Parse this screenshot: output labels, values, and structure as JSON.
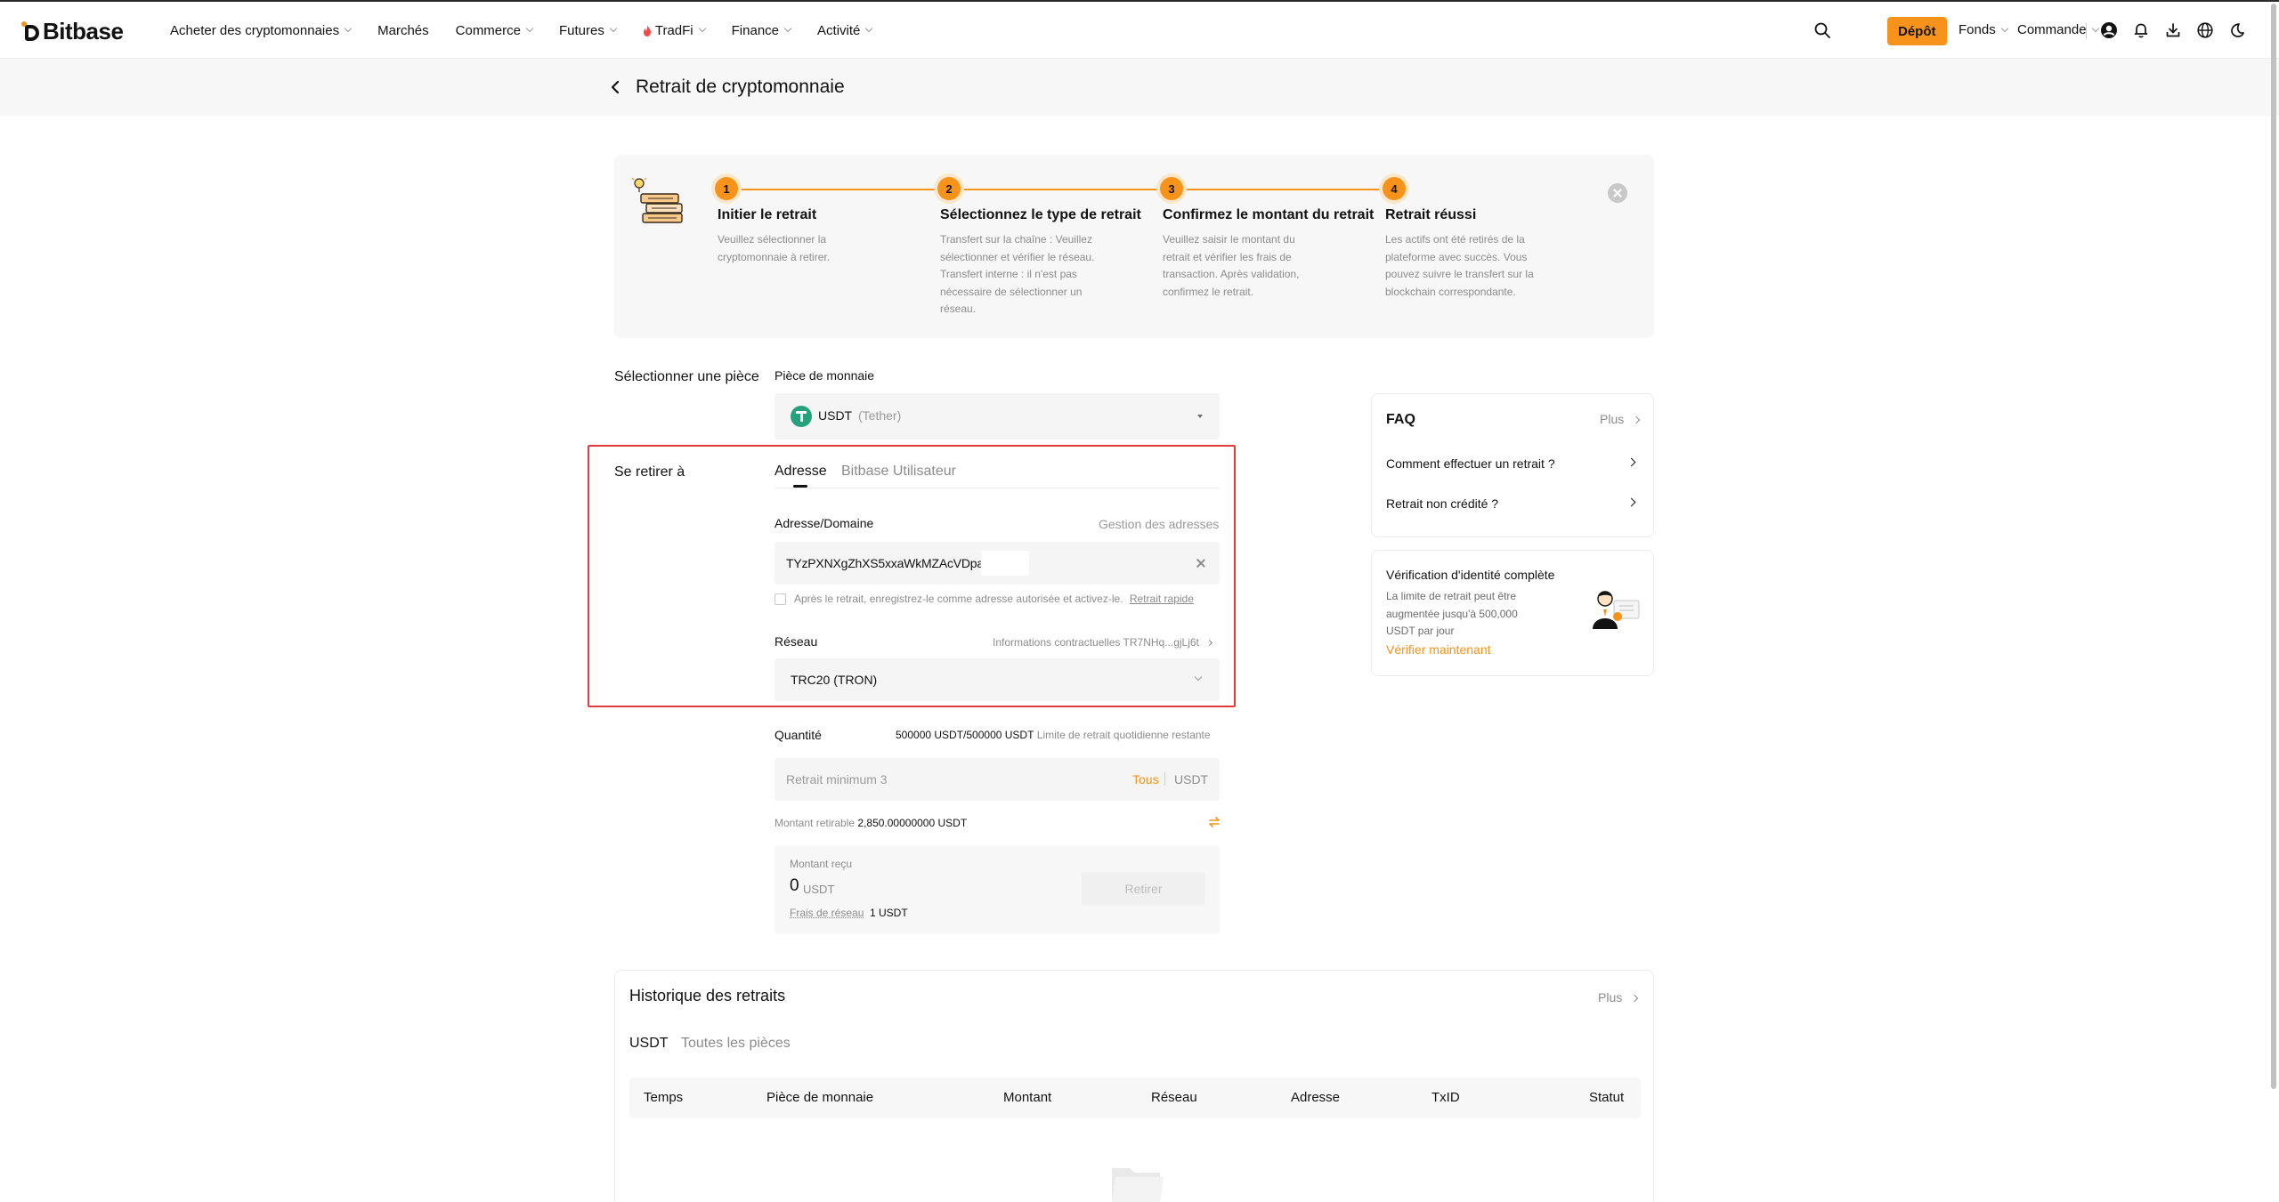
{
  "nav": {
    "logo_text": "Bitbase",
    "items": [
      {
        "label": "Acheter des cryptomonnaies",
        "chevron": true
      },
      {
        "label": "Marchés",
        "chevron": false
      },
      {
        "label": "Commerce",
        "chevron": true
      },
      {
        "label": "Futures",
        "chevron": true
      },
      {
        "label": "TradFi",
        "chevron": true,
        "icon": "flame-icon"
      },
      {
        "label": "Finance",
        "chevron": true
      },
      {
        "label": "Activité",
        "chevron": true
      }
    ],
    "deposit_label": "Dépôt",
    "funds_label": "Fonds",
    "order_label": "Commande",
    "icons": [
      "search-icon",
      "account-icon",
      "bell-icon",
      "download-icon",
      "globe-icon",
      "theme-icon"
    ]
  },
  "page": {
    "title": "Retrait de cryptomonnaie"
  },
  "steps": [
    {
      "num": "1",
      "title": "Initier le retrait",
      "desc": "Veuillez sélectionner la cryptomonnaie à retirer."
    },
    {
      "num": "2",
      "title": "Sélectionnez le type de retrait",
      "desc": "Transfert sur la chaîne : Veuillez sélectionner et vérifier le réseau. Transfert interne : il n'est pas nécessaire de sélectionner un réseau."
    },
    {
      "num": "3",
      "title": "Confirmez le montant du retrait",
      "desc": "Veuillez saisir le montant du retrait et vérifier les frais de transaction. Après validation, confirmez le retrait."
    },
    {
      "num": "4",
      "title": "Retrait réussi",
      "desc": "Les actifs ont été retirés de la plateforme avec succès. Vous pouvez suivre le transfert sur la blockchain correspondante."
    }
  ],
  "coin_section": {
    "label": "Sélectionner une pièce",
    "field_label": "Pièce de monnaie",
    "coin": "USDT",
    "coin_name": "(Tether)"
  },
  "withdraw_to": {
    "label": "Se retirer à",
    "tabs": [
      "Adresse",
      "Bitbase Utilisateur"
    ],
    "address_label": "Adresse/Domaine",
    "address_manage": "Gestion des adresses",
    "address_value": "TYzPXNXgZhXS5xxaWkMZAcVDpa",
    "checkbox_text": "Après le retrait, enregistrez-le comme adresse autorisée et activez-le.",
    "checkbox_link": "Retrait rapide",
    "network_label": "Réseau",
    "contract_info": "Informations contractuelles TR7NHq...gjLj6t",
    "network_value": "TRC20 (TRON)"
  },
  "quantity": {
    "label": "Quantité",
    "limit_value": "500000 USDT/500000 USDT",
    "limit_text": "Limite de retrait quotidienne restante",
    "placeholder": "Retrait minimum 3",
    "all_label": "Tous",
    "unit": "USDT",
    "withdrawable_label": "Montant retirable",
    "withdrawable_value": "2,850.00000000 USDT",
    "received_label": "Montant reçu",
    "received_value": "0",
    "received_unit": "USDT",
    "fee_label": "Frais de réseau",
    "fee_value": "1 USDT",
    "submit_label": "Retirer"
  },
  "faq": {
    "title": "FAQ",
    "more": "Plus",
    "items": [
      "Comment effectuer un retrait ?",
      "Retrait non crédité ?"
    ]
  },
  "kyc": {
    "title": "Vérification d'identité complète",
    "desc": "La limite de retrait peut être augmentée jusqu'à 500,000 USDT par jour",
    "link": "Vérifier maintenant"
  },
  "history": {
    "title": "Historique des retraits",
    "more": "Plus",
    "tabs": [
      "USDT",
      "Toutes les pièces"
    ],
    "columns": [
      "Temps",
      "Pièce de monnaie",
      "Montant",
      "Réseau",
      "Adresse",
      "TxID",
      "Statut"
    ]
  },
  "colors": {
    "accent": "#f7931a",
    "highlight_border": "#e23b3b",
    "tether": "#26a17b"
  }
}
